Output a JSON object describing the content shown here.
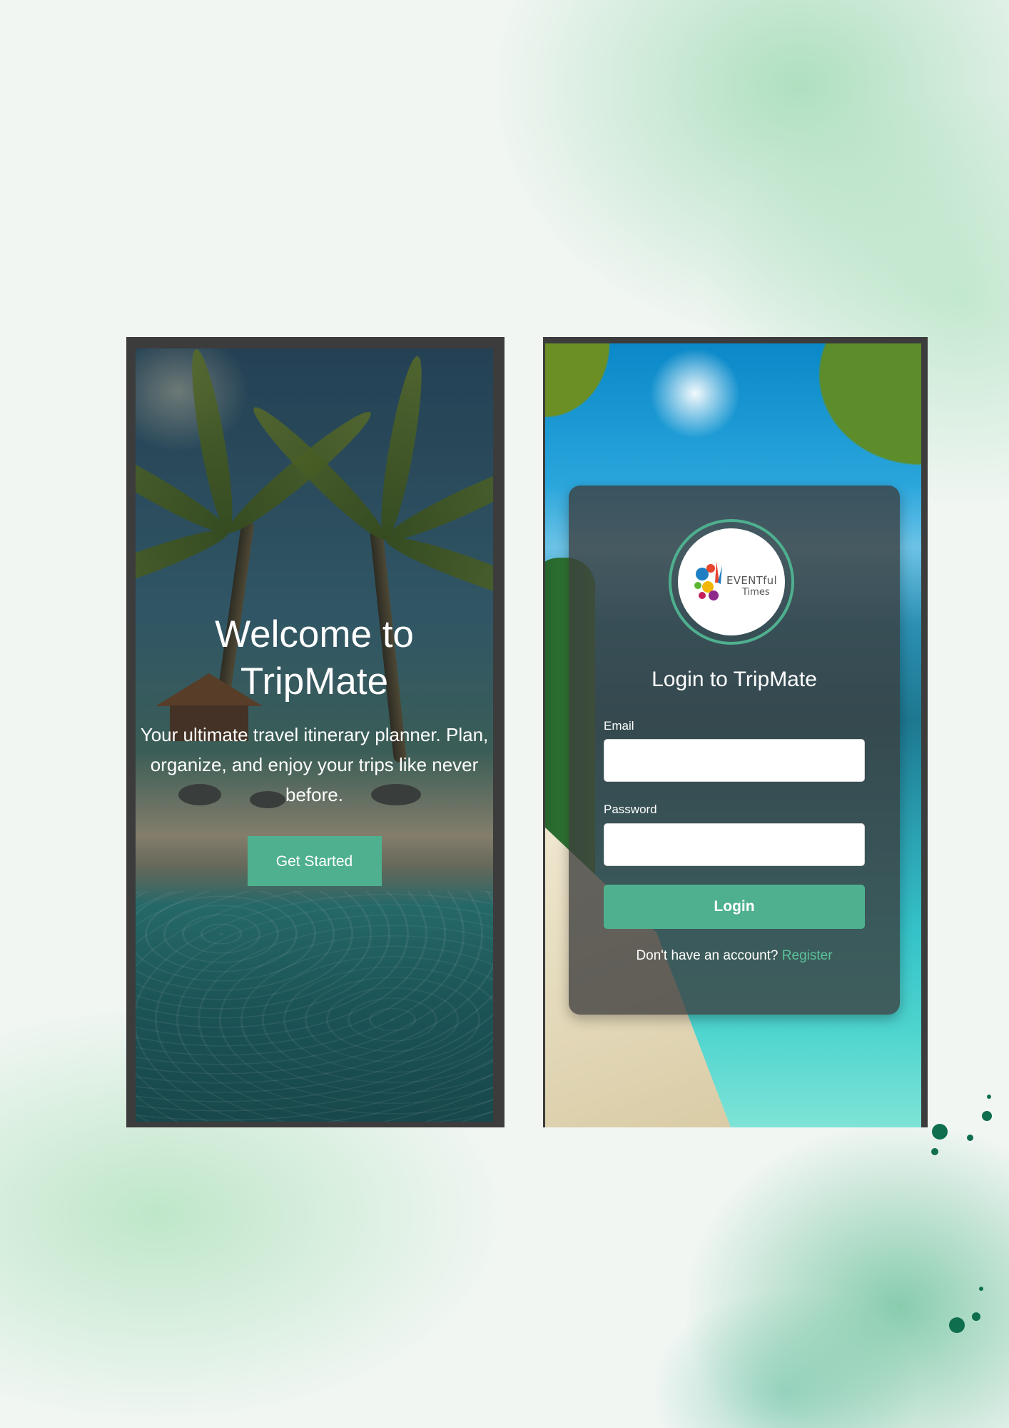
{
  "welcome": {
    "title_line1": "Welcome to",
    "title_line2": "TripMate",
    "subtitle": "Your ultimate travel itinerary planner. Plan, organize, and enjoy your trips like never before.",
    "cta_label": "Get Started"
  },
  "login": {
    "logo": {
      "line1": "EVENTful",
      "line2": "Times"
    },
    "title": "Login to TripMate",
    "email_label": "Email",
    "email_value": "",
    "password_label": "Password",
    "password_value": "",
    "button_label": "Login",
    "register_prompt": "Don't have an account?",
    "register_link": "Register"
  },
  "theme": {
    "accent": "#4eb08e",
    "link": "#5cc39c",
    "frame": "#3c3c3c",
    "card": "#3c3c3c"
  }
}
